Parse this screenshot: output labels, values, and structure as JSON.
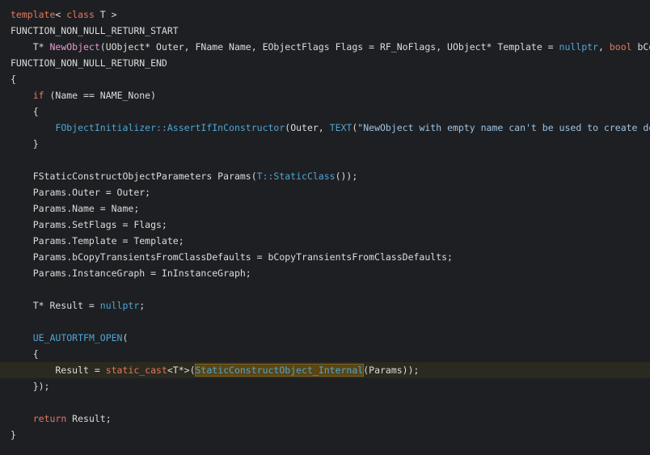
{
  "editor": {
    "lines": [
      [
        {
          "t": "template",
          "c": "kw"
        },
        {
          "t": "< ",
          "c": "pl"
        },
        {
          "t": "class",
          "c": "kw"
        },
        {
          "t": " T >",
          "c": "pl"
        }
      ],
      [
        {
          "t": "FUNCTION_NON_NULL_RETURN_START",
          "c": "pl"
        }
      ],
      [
        {
          "t": "    T* ",
          "c": "pl"
        },
        {
          "t": "NewObject",
          "c": "fn"
        },
        {
          "t": "(UObject* Outer, FName Name, EObjectFlags Flags = RF_NoFlags, UObject* Template = ",
          "c": "pl"
        },
        {
          "t": "nullptr",
          "c": "lit"
        },
        {
          "t": ", ",
          "c": "pl"
        },
        {
          "t": "bool",
          "c": "kw"
        },
        {
          "t": " bCopyTransientsFromClassDefaults = false",
          "c": "pl"
        }
      ],
      [
        {
          "t": "FUNCTION_NON_NULL_RETURN_END",
          "c": "pl"
        }
      ],
      [
        {
          "t": "{",
          "c": "pl"
        }
      ],
      [
        {
          "t": "    ",
          "c": "pl"
        },
        {
          "t": "if",
          "c": "kw"
        },
        {
          "t": " (Name == NAME_None)",
          "c": "pl"
        }
      ],
      [
        {
          "t": "    {",
          "c": "pl"
        }
      ],
      [
        {
          "t": "        ",
          "c": "pl"
        },
        {
          "t": "FObjectInitializer::AssertIfInConstructor",
          "c": "call"
        },
        {
          "t": "(Outer, ",
          "c": "pl"
        },
        {
          "t": "TEXT",
          "c": "lit"
        },
        {
          "t": "(",
          "c": "pl"
        },
        {
          "t": "\"NewObject with empty name can't be used to create default subobjects\"",
          "c": "str"
        }
      ],
      [
        {
          "t": "    }",
          "c": "pl"
        }
      ],
      [
        {
          "t": "",
          "c": "pl"
        }
      ],
      [
        {
          "t": "    FStaticConstructObjectParameters Params(",
          "c": "pl"
        },
        {
          "t": "T::StaticClass",
          "c": "call"
        },
        {
          "t": "());",
          "c": "pl"
        }
      ],
      [
        {
          "t": "    Params.Outer = Outer;",
          "c": "pl"
        }
      ],
      [
        {
          "t": "    Params.Name = Name;",
          "c": "pl"
        }
      ],
      [
        {
          "t": "    Params.SetFlags = Flags;",
          "c": "pl"
        }
      ],
      [
        {
          "t": "    Params.Template = Template;",
          "c": "pl"
        }
      ],
      [
        {
          "t": "    Params.bCopyTransientsFromClassDefaults = bCopyTransientsFromClassDefaults;",
          "c": "pl"
        }
      ],
      [
        {
          "t": "    Params.InstanceGraph = InInstanceGraph;",
          "c": "pl"
        }
      ],
      [
        {
          "t": "",
          "c": "pl"
        }
      ],
      [
        {
          "t": "    T* Result = ",
          "c": "pl"
        },
        {
          "t": "nullptr",
          "c": "lit"
        },
        {
          "t": ";",
          "c": "pl"
        }
      ],
      [
        {
          "t": "",
          "c": "pl"
        }
      ],
      [
        {
          "t": "    ",
          "c": "pl"
        },
        {
          "t": "UE_AUTORTFM_OPEN",
          "c": "call"
        },
        {
          "t": "(",
          "c": "pl"
        }
      ],
      [
        {
          "t": "    {",
          "c": "pl"
        }
      ],
      [
        {
          "t": "        Result = ",
          "c": "pl"
        },
        {
          "t": "static_cast",
          "c": "kw"
        },
        {
          "t": "<T*>(",
          "c": "pl"
        },
        {
          "t": "StaticConstructObject_Internal",
          "c": "call",
          "hl": true
        },
        {
          "t": "(Params));",
          "c": "pl"
        }
      ],
      [
        {
          "t": "    });",
          "c": "pl"
        }
      ],
      [
        {
          "t": "",
          "c": "pl"
        }
      ],
      [
        {
          "t": "    ",
          "c": "pl"
        },
        {
          "t": "return",
          "c": "kw"
        },
        {
          "t": " Result;",
          "c": "pl"
        }
      ],
      [
        {
          "t": "}",
          "c": "pl"
        }
      ]
    ],
    "current_line_index": 22
  },
  "colors": {
    "background": "#1e1f22",
    "keyword": "#e07a5f",
    "function_def": "#e49ad7",
    "call": "#4fa6d6",
    "string": "#9cc4e4",
    "text": "#dcdcdc",
    "current_line": "#2b2a20",
    "symbol_highlight": "#5a4513"
  }
}
